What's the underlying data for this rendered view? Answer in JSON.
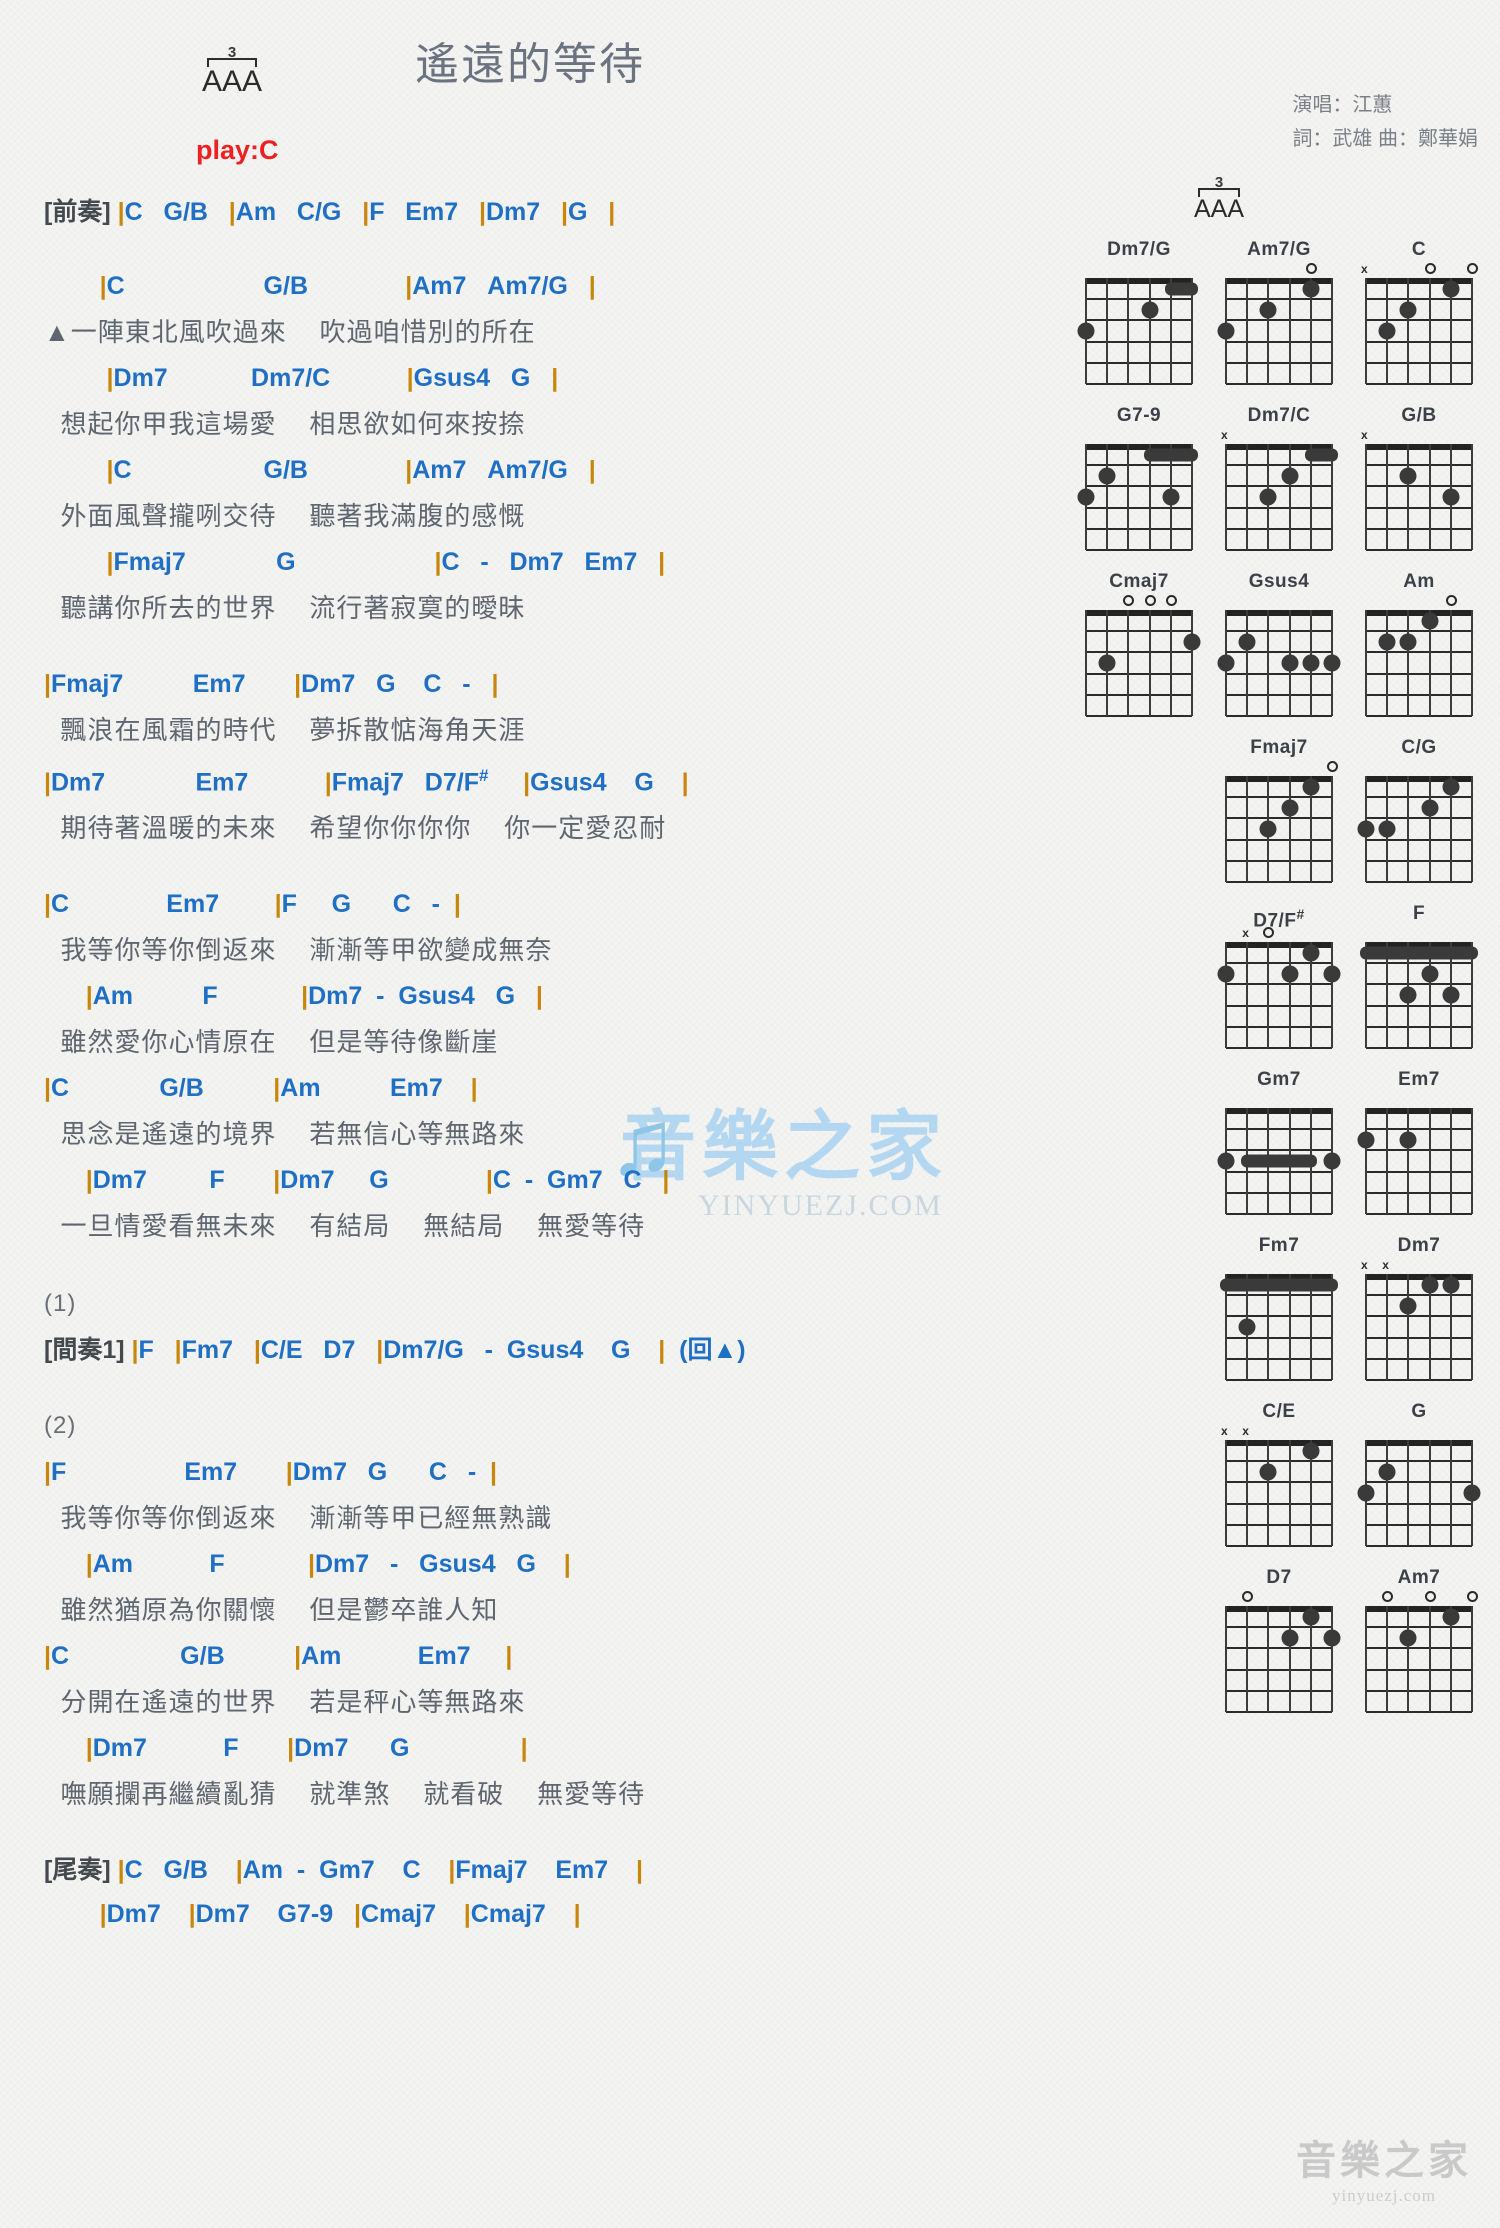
{
  "header": {
    "title": "遙遠的等待",
    "play_key": "play:C",
    "triplet_number": "3",
    "triplet_letters": "AAA",
    "credits": [
      "演唱：江蕙",
      "詞：武雄   曲：鄭華娟"
    ]
  },
  "sections": [
    {
      "type": "chord_only",
      "label": "[前奏]",
      "chords": "|C   G/B   |Am   C/G   |F   Em7   |Dm7   |G   |"
    },
    {
      "type": "gap"
    },
    {
      "type": "verse",
      "lines": [
        {
          "chords": "        |C                    G/B              |Am7   Am7/G   |",
          "lyric": "▲一陣東北風吹過來    吹過咱惜別的所在"
        },
        {
          "chords": "         |Dm7            Dm7/C           |Gsus4   G   |",
          "lyric": "  想起你甲我這場愛    相思欲如何來按捺"
        },
        {
          "chords": "         |C                   G/B              |Am7   Am7/G   |",
          "lyric": "  外面風聲攏咧交待    聽著我滿腹的感慨"
        },
        {
          "chords": "         |Fmaj7             G                    |C   -   Dm7   Em7   |",
          "lyric": "  聽講你所去的世界    流行著寂寞的曖昧"
        }
      ]
    },
    {
      "type": "gap"
    },
    {
      "type": "verse",
      "lines": [
        {
          "chords": "|Fmaj7          Em7       |Dm7   G    C   -   |",
          "lyric": "  飄浪在風霜的時代    夢拆散惦海角天涯"
        },
        {
          "chords": "|Dm7             Em7           |Fmaj7   D7/F#     |Gsus4    G    |",
          "lyric": "  期待著溫暖的未來    希望你你你你    你一定愛忍耐"
        }
      ]
    },
    {
      "type": "gap"
    },
    {
      "type": "chorus",
      "lines": [
        {
          "chords": "|C              Em7        |F     G      C   -  |",
          "lyric": "  我等你等你倒返來    漸漸等甲欲變成無奈"
        },
        {
          "chords": "      |Am          F            |Dm7  -  Gsus4   G   |",
          "lyric": "  雖然愛你心情原在    但是等待像斷崖"
        },
        {
          "chords": "|C             G/B          |Am          Em7    |",
          "lyric": "  思念是遙遠的境界    若無信心等無路來"
        },
        {
          "chords": "      |Dm7         F       |Dm7     G              |C  -  Gm7   C   |",
          "lyric": "  一旦情愛看無未來    有結局    無結局    無愛等待"
        }
      ]
    },
    {
      "type": "gap"
    },
    {
      "type": "repeat_marker",
      "label": "(1)"
    },
    {
      "type": "chord_only",
      "label": "[間奏1]",
      "chords": "|F   |Fm7   |C/E   D7   |Dm7/G   -  Gsus4    G    |  (回▲)"
    },
    {
      "type": "gap"
    },
    {
      "type": "repeat_marker",
      "label": "(2)"
    },
    {
      "type": "verse2",
      "lines": [
        {
          "chords": "|F                 Em7       |Dm7   G      C   -  |",
          "lyric": "  我等你等你倒返來    漸漸等甲已經無熟識"
        },
        {
          "chords": "      |Am           F            |Dm7   -   Gsus4   G    |",
          "lyric": "  雖然猶原為你關懷    但是鬱卒誰人知"
        },
        {
          "chords": "|C                G/B          |Am           Em7     |",
          "lyric": "  分開在遙遠的世界    若是秤心等無路來"
        },
        {
          "chords": "      |Dm7           F       |Dm7      G                |",
          "lyric": "  嘸願攔再繼續亂猜    就準煞    就看破    無愛等待"
        }
      ]
    },
    {
      "type": "gap"
    },
    {
      "type": "outro",
      "label": "[尾奏]",
      "lines": [
        "|C   G/B    |Am  -  Gm7    C    |Fmaj7    Em7    |",
        "        |Dm7    |Dm7    G7-9   |Cmaj7    |Cmaj7    |"
      ]
    }
  ],
  "chord_diagrams": [
    {
      "name": "Dm7/G",
      "markers": [],
      "barre": null,
      "barres": [
        {
          "fret": 1,
          "from": 4,
          "to": 5
        }
      ],
      "dots": [
        {
          "s": 0,
          "f": 3
        },
        {
          "s": 3,
          "f": 2
        }
      ]
    },
    {
      "name": "Am7/G",
      "markers": [
        {
          "type": "o",
          "s": 4
        }
      ],
      "dots": [
        {
          "s": 0,
          "f": 3
        },
        {
          "s": 2,
          "f": 2
        },
        {
          "s": 4,
          "f": 1
        }
      ]
    },
    {
      "name": "C",
      "markers": [
        {
          "type": "x",
          "s": 0
        },
        {
          "type": "o",
          "s": 3
        },
        {
          "type": "o",
          "s": 5
        }
      ],
      "dots": [
        {
          "s": 1,
          "f": 3
        },
        {
          "s": 2,
          "f": 2
        },
        {
          "s": 4,
          "f": 1
        }
      ]
    },
    {
      "name": "G7-9",
      "markers": [],
      "barres": [
        {
          "fret": 1,
          "from": 3,
          "to": 5
        }
      ],
      "dots": [
        {
          "s": 1,
          "f": 2
        },
        {
          "s": 0,
          "f": 3
        },
        {
          "s": 4,
          "f": 3
        }
      ]
    },
    {
      "name": "Dm7/C",
      "markers": [
        {
          "type": "x",
          "s": 0
        }
      ],
      "barres": [
        {
          "fret": 1,
          "from": 4,
          "to": 5
        }
      ],
      "dots": [
        {
          "s": 3,
          "f": 2
        },
        {
          "s": 2,
          "f": 3
        }
      ]
    },
    {
      "name": "G/B",
      "markers": [
        {
          "type": "x",
          "s": 0
        }
      ],
      "dots": [
        {
          "s": 2,
          "f": 2
        },
        {
          "s": 4,
          "f": 3
        }
      ]
    },
    {
      "name": "Cmaj7",
      "markers": [
        {
          "type": "o",
          "s": 2
        },
        {
          "type": "o",
          "s": 3
        },
        {
          "type": "o",
          "s": 4
        }
      ],
      "dots": [
        {
          "s": 1,
          "f": 3
        },
        {
          "s": 5,
          "f": 2
        }
      ]
    },
    {
      "name": "Gsus4",
      "markers": [],
      "dots": [
        {
          "s": 1,
          "f": 2
        },
        {
          "s": 0,
          "f": 3
        },
        {
          "s": 3,
          "f": 3
        },
        {
          "s": 4,
          "f": 3
        },
        {
          "s": 5,
          "f": 3
        }
      ]
    },
    {
      "name": "Am",
      "markers": [
        {
          "type": "o",
          "s": 4
        }
      ],
      "dots": [
        {
          "s": 1,
          "f": 2
        },
        {
          "s": 2,
          "f": 2
        },
        {
          "s": 3,
          "f": 1
        }
      ]
    },
    {
      "name": "Fmaj7",
      "markers": [
        {
          "type": "o",
          "s": 5
        }
      ],
      "dots": [
        {
          "s": 4,
          "f": 1
        },
        {
          "s": 3,
          "f": 2
        },
        {
          "s": 2,
          "f": 3
        }
      ]
    },
    {
      "name": "C/G",
      "markers": [],
      "dots": [
        {
          "s": 4,
          "f": 1
        },
        {
          "s": 3,
          "f": 2
        },
        {
          "s": 1,
          "f": 3
        },
        {
          "s": 0,
          "f": 3
        }
      ]
    },
    {
      "name": "D7/F#",
      "markers": [
        {
          "type": "x",
          "s": 1
        },
        {
          "type": "o",
          "s": 2
        }
      ],
      "dots": [
        {
          "s": 4,
          "f": 1
        },
        {
          "s": 0,
          "f": 2
        },
        {
          "s": 3,
          "f": 2
        },
        {
          "s": 5,
          "f": 2
        }
      ]
    },
    {
      "name": "F",
      "markers": [],
      "barres": [
        {
          "fret": 1,
          "from": 0,
          "to": 5
        }
      ],
      "dots": [
        {
          "s": 3,
          "f": 2
        },
        {
          "s": 2,
          "f": 3
        },
        {
          "s": 4,
          "f": 3
        }
      ]
    },
    {
      "name": "Gm7",
      "markers": [],
      "barres": [
        {
          "fret": 3,
          "from": 1,
          "to": 4
        }
      ],
      "dots": [
        {
          "s": 0,
          "f": 3
        },
        {
          "s": 5,
          "f": 3
        }
      ]
    },
    {
      "name": "Em7",
      "markers": [],
      "dots": [
        {
          "s": 0,
          "f": 2
        },
        {
          "s": 2,
          "f": 2
        }
      ]
    },
    {
      "name": "Fm7",
      "markers": [],
      "barres": [
        {
          "fret": 1,
          "from": 0,
          "to": 5
        }
      ],
      "dots": [
        {
          "s": 1,
          "f": 3
        }
      ]
    },
    {
      "name": "Dm7",
      "markers": [
        {
          "type": "x",
          "s": 0
        },
        {
          "type": "x",
          "s": 1
        }
      ],
      "dots": [
        {
          "s": 4,
          "f": 1
        },
        {
          "s": 2,
          "f": 2
        },
        {
          "s": 3,
          "f": 1
        }
      ]
    },
    {
      "name": "C/E",
      "markers": [
        {
          "type": "x",
          "s": 0
        },
        {
          "type": "x",
          "s": 1
        }
      ],
      "dots": [
        {
          "s": 4,
          "f": 1
        },
        {
          "s": 2,
          "f": 2
        }
      ]
    },
    {
      "name": "G",
      "markers": [],
      "dots": [
        {
          "s": 1,
          "f": 2
        },
        {
          "s": 0,
          "f": 3
        },
        {
          "s": 5,
          "f": 3
        }
      ]
    },
    {
      "name": "D7",
      "markers": [
        {
          "type": "o",
          "s": 1
        }
      ],
      "dots": [
        {
          "s": 4,
          "f": 1
        },
        {
          "s": 3,
          "f": 2
        },
        {
          "s": 5,
          "f": 2
        }
      ]
    },
    {
      "name": "Am7",
      "markers": [
        {
          "type": "o",
          "s": 1
        },
        {
          "type": "o",
          "s": 3
        },
        {
          "type": "o",
          "s": 5
        }
      ],
      "dots": [
        {
          "s": 4,
          "f": 1
        },
        {
          "s": 2,
          "f": 2
        }
      ]
    }
  ],
  "watermark": {
    "main_cn": "音樂之家",
    "main_en": "YINYUEZJ.COM",
    "corner_cn": "音樂之家",
    "corner_en": "yinyuezj.com"
  },
  "colors": {
    "chord": "#1f6fc4",
    "lyric": "#5f6670",
    "barline": "#c8860a",
    "playkey": "#ef2020",
    "title": "#6b7280"
  }
}
